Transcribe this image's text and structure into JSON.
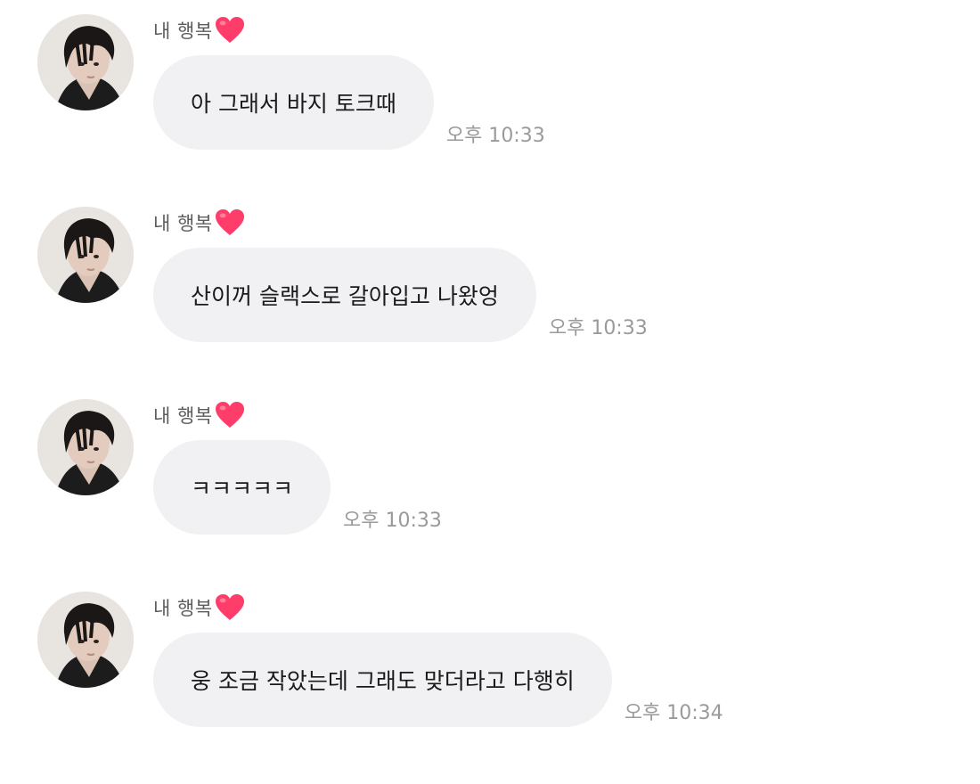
{
  "messages": [
    {
      "sender": "내 행복",
      "text": "아 그래서 바지 토크때",
      "time": "오후 10:33"
    },
    {
      "sender": "내 행복",
      "text": "산이꺼 슬랙스로 갈아입고 나왔엉",
      "time": "오후 10:33"
    },
    {
      "sender": "내 행복",
      "text": "ㅋㅋㅋㅋㅋ",
      "time": "오후 10:33"
    },
    {
      "sender": "내 행복",
      "text": "웅 조금 작았는데 그래도 맞더라고 다행히",
      "time": "오후 10:34"
    }
  ],
  "icons": {
    "sender_badge": "heart-icon",
    "avatar": "profile-photo"
  },
  "colors": {
    "bubble": "#f1f1f3",
    "heart": "#ff3d6a",
    "timestamp": "#9a9a9a"
  }
}
